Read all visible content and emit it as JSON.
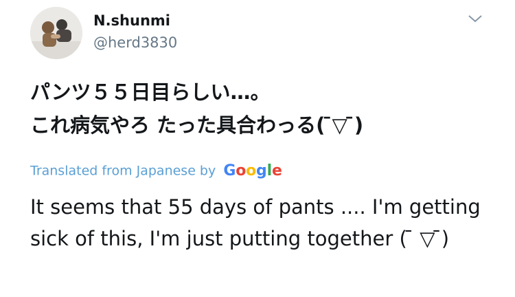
{
  "author": {
    "name": "N.shunmi",
    "handle": "@herd3830"
  },
  "tweet": {
    "text_lines": [
      "パンツ５５日目らしい…。",
      "これ病気やろ たった具合わっる( ̄▽ ̄)"
    ]
  },
  "translation": {
    "label": "Translated from Japanese by",
    "provider_letters": [
      "G",
      "o",
      "o",
      "g",
      "l",
      "e"
    ],
    "provider_colors": [
      "#4285F4",
      "#EA4335",
      "#FBBC05",
      "#4285F4",
      "#34A853",
      "#EA4335"
    ],
    "text": "It seems that 55 days of pants .... I'm getting sick of this, I'm just putting together ( ̄ ▽ ̄)"
  },
  "icons": {
    "menu": "chevron-down-icon"
  },
  "colors": {
    "text_primary": "#14171a",
    "text_secondary": "#657786",
    "link_blue": "#5a9fd4"
  }
}
